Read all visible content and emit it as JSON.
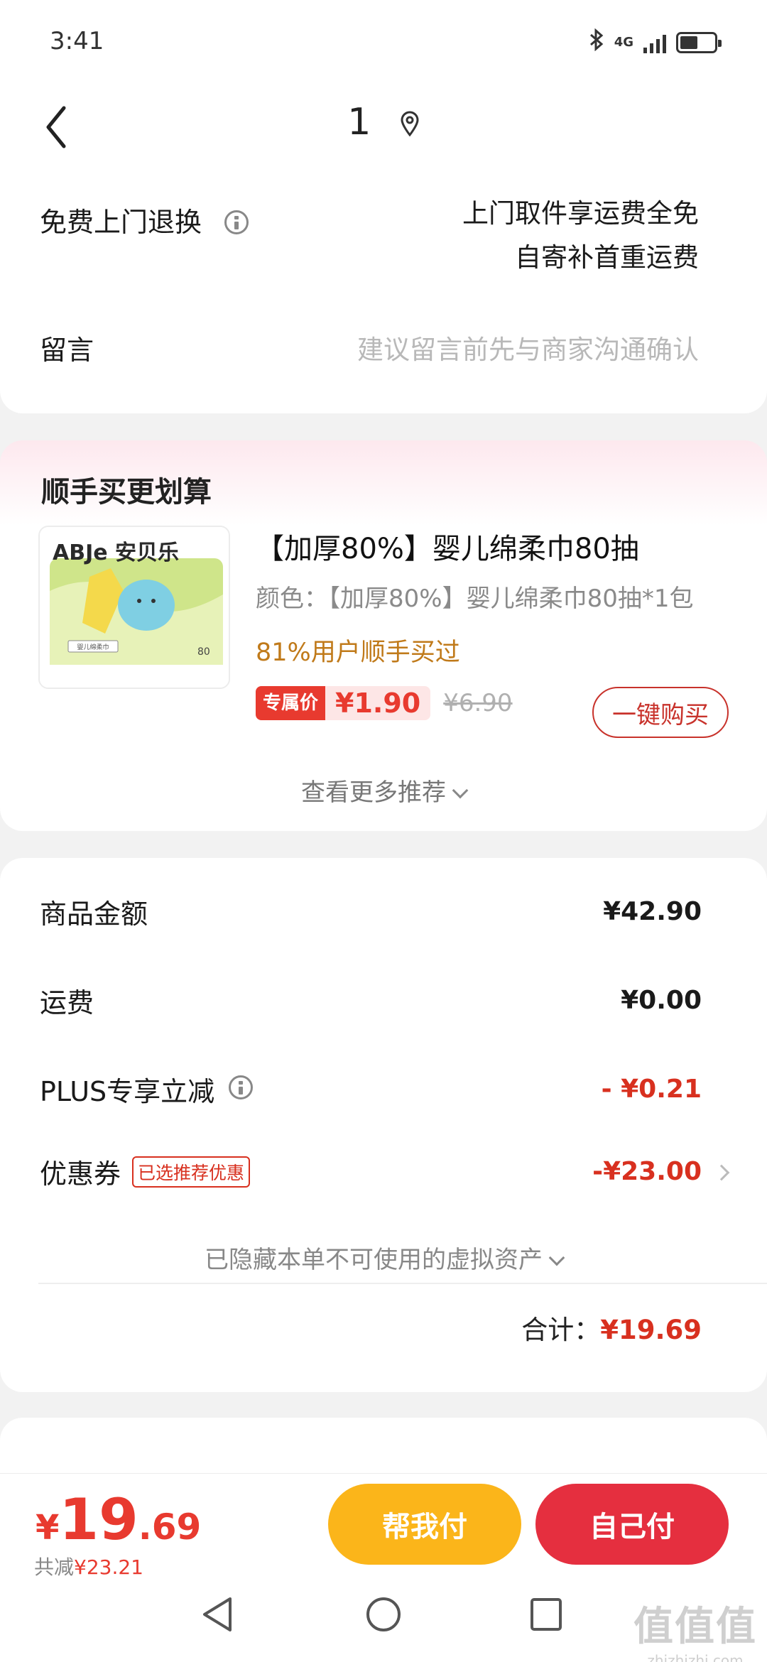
{
  "status_bar": {
    "time": "3:41",
    "network": "4G"
  },
  "header": {
    "title": "1"
  },
  "return_row": {
    "label": "免费上门退换",
    "line1": "上门取件享运费全免",
    "line2": "自寄补首重运费"
  },
  "message_row": {
    "label": "留言",
    "placeholder": "建议留言前先与商家沟通确认"
  },
  "recommend": {
    "title": "顺手买更划算",
    "product": {
      "name": "【加厚80%】婴儿绵柔巾80抽",
      "spec": "颜色：【加厚80%】婴儿绵柔巾80抽*1包",
      "bought": "81%用户顺手买过",
      "badge": "专属价",
      "price": "¥1.90",
      "old_price": "¥6.90",
      "buy_label": "一键购买",
      "image": {
        "brand": "ABJe 安贝乐",
        "pack_label": "婴儿绵柔巾",
        "count": "80"
      }
    },
    "more_label": "查看更多推荐"
  },
  "price_detail": {
    "goods_label": "商品金额",
    "goods_value": "¥42.90",
    "shipping_label": "运费",
    "shipping_value": "¥0.00",
    "plus_label": "PLUS专享立减",
    "plus_value": "- ¥0.21",
    "coupon_label": "优惠券",
    "coupon_tag": "已选推荐优惠",
    "coupon_value": "-¥23.00",
    "hidden_note": "已隐藏本单不可使用的虚拟资产",
    "total_label": "合计：",
    "total_value": "¥19.69"
  },
  "bottom": {
    "price_symbol": "¥",
    "price_int": "19",
    "price_dec": ".69",
    "saved_label": "共减",
    "saved_value": "¥23.21",
    "help_pay": "帮我付",
    "self_pay": "自己付"
  },
  "watermark": {
    "logo": "值值值",
    "site": "zhizhizhi.com"
  },
  "colors": {
    "accent_red": "#e83a2f",
    "yellow": "#fbb51a",
    "pay_red": "#e52f3f",
    "orange_text": "#c07a1a"
  }
}
